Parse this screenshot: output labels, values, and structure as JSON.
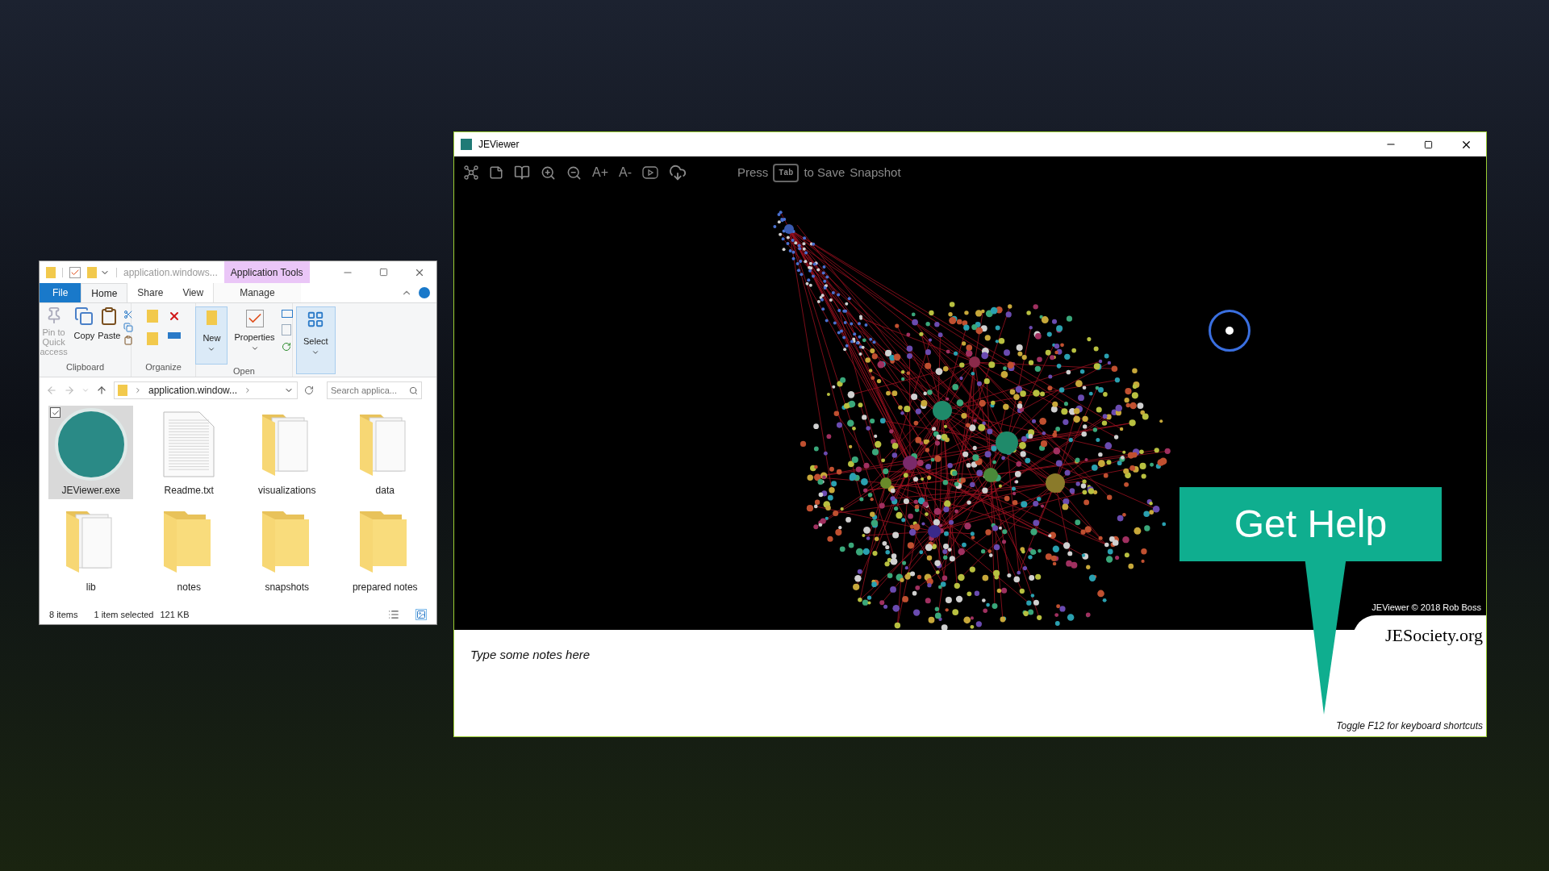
{
  "explorer": {
    "title": "application.windows...",
    "context_tab": "Application Tools",
    "tabs": [
      {
        "label": "File",
        "kind": "file",
        "selected": false
      },
      {
        "label": "Home",
        "kind": "tab",
        "selected": true
      },
      {
        "label": "Share",
        "kind": "tab",
        "selected": false
      },
      {
        "label": "View",
        "kind": "tab",
        "selected": false
      },
      {
        "label": "Manage",
        "kind": "context",
        "selected": false
      }
    ],
    "ribbon": {
      "pin": {
        "label": "Pin to Quick access",
        "disabled": true
      },
      "copy": "Copy",
      "paste": "Paste",
      "clipboard": "Clipboard",
      "organize": "Organize",
      "new": "New",
      "properties": "Properties",
      "open": "Open",
      "select": "Select"
    },
    "address": "application.window...",
    "search": {
      "placeholder": "Search applica..."
    },
    "files": [
      {
        "name": "JEViewer.exe",
        "kind": "app",
        "selected": true
      },
      {
        "name": "Readme.txt",
        "kind": "document",
        "selected": false
      },
      {
        "name": "visualizations",
        "kind": "folder-docs",
        "selected": false
      },
      {
        "name": "data",
        "kind": "folder-docs",
        "selected": false
      },
      {
        "name": "lib",
        "kind": "folder-docs",
        "selected": false
      },
      {
        "name": "notes",
        "kind": "folder",
        "selected": false
      },
      {
        "name": "snapshots",
        "kind": "folder",
        "selected": false
      },
      {
        "name": "prepared notes",
        "kind": "folder",
        "selected": false
      }
    ],
    "status": {
      "count": "8 items",
      "selection": "1 item selected",
      "size": "121 KB"
    }
  },
  "viewer": {
    "title": "JEViewer",
    "font_larger": "A+",
    "font_smaller": "A-",
    "hint": {
      "before": "Press",
      "key": "Tab",
      "after": "to Save",
      "last": "Snapshot"
    },
    "copyright": "JEViewer © 2018 Rob Boss",
    "logo": "JESociety.org",
    "notes": {
      "placeholder": "Type some notes here"
    },
    "shortcut_hint": "Toggle F12 for keyboard shortcuts"
  },
  "callout": {
    "label": "Get Help"
  }
}
